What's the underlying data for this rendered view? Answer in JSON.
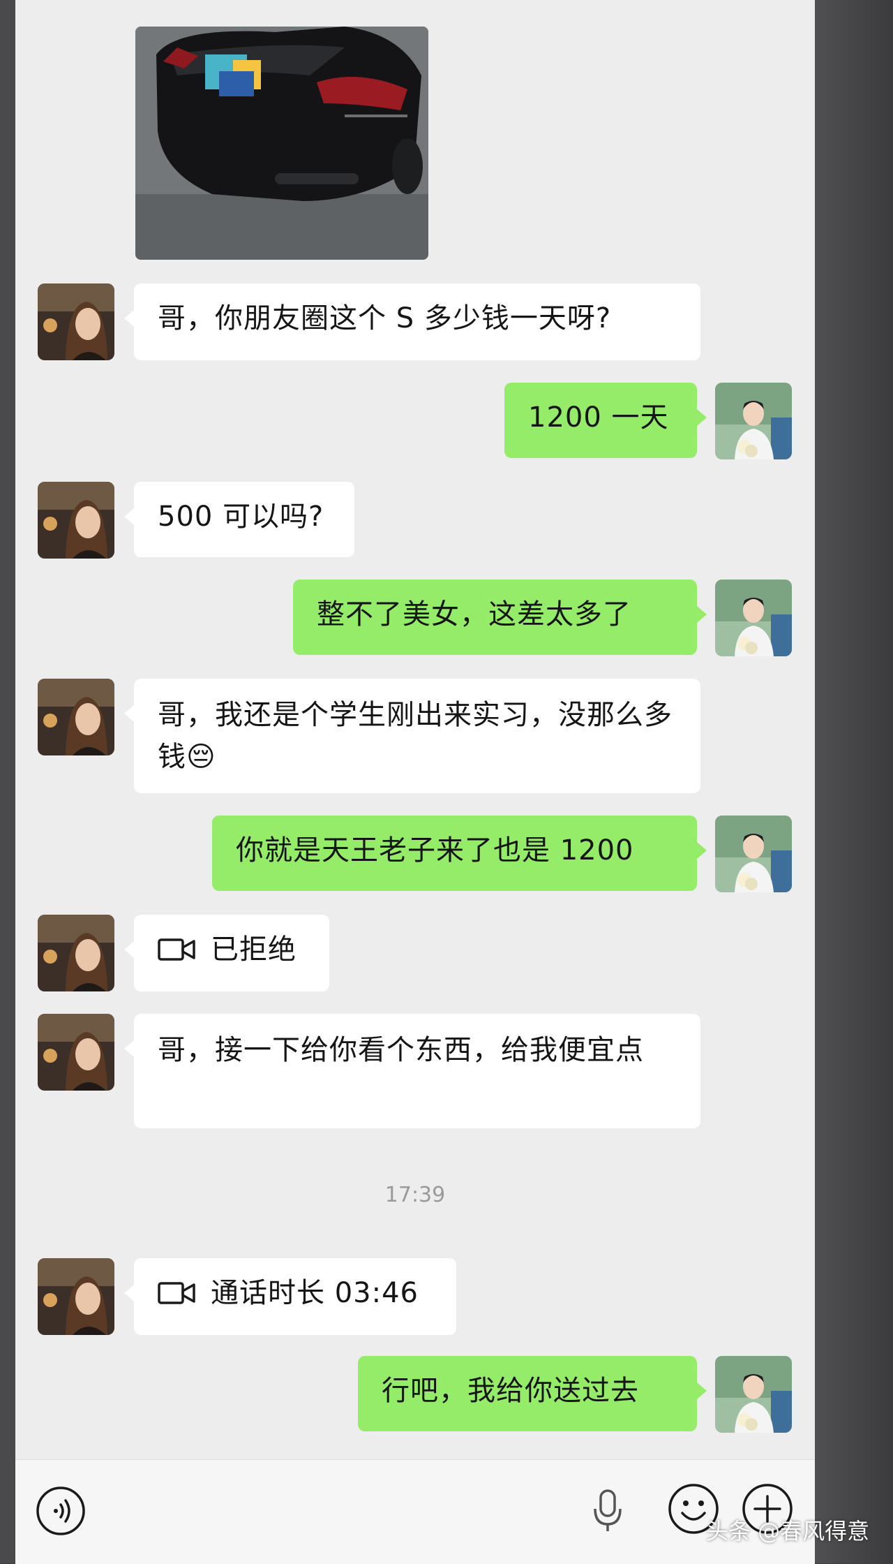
{
  "messages": [
    {
      "from": "other",
      "text": "哥，你朋友圈这个 S 多少钱一天呀?"
    },
    {
      "from": "me",
      "text": "1200 一天"
    },
    {
      "from": "other",
      "text": "500 可以吗?"
    },
    {
      "from": "me",
      "text": "整不了美女，这差太多了"
    },
    {
      "from": "other",
      "text": "哥，我还是个学生刚出来实习，没那么多钱😔"
    },
    {
      "from": "me",
      "text": "你就是天王老子来了也是 1200"
    },
    {
      "from": "other",
      "text": "已拒绝",
      "icon": "video-call-icon"
    },
    {
      "from": "other",
      "text": "哥，接一下给你看个东西，给我便宜点"
    },
    {
      "from": "other",
      "text": "通话时长 03:46",
      "icon": "video-call-icon"
    },
    {
      "from": "me",
      "text": "行吧，我给你送过去"
    }
  ],
  "timestamp": "17:39",
  "input_bar": {
    "icons": [
      "voice-icon",
      "microphone-icon",
      "emoji-icon",
      "plus-icon"
    ]
  },
  "watermark": "头条 @春风得意",
  "colors": {
    "background": "#ededed",
    "outgoing_bubble": "#95ec69",
    "incoming_bubble": "#ffffff",
    "timestamp": "#9a9a9a"
  }
}
